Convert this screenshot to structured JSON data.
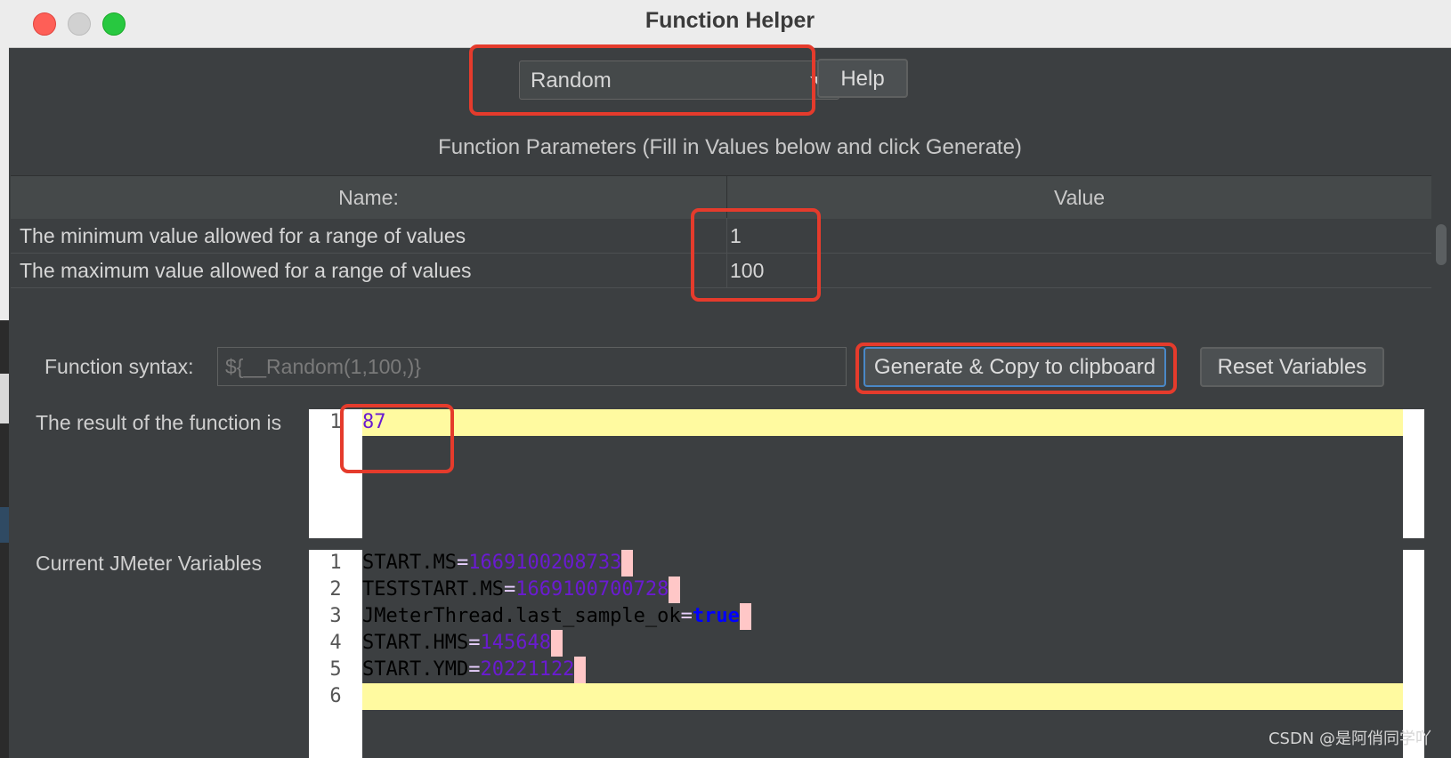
{
  "window": {
    "title": "Function Helper"
  },
  "top": {
    "function_select": "Random",
    "help_button": "Help"
  },
  "params": {
    "heading": "Function Parameters (Fill in Values below and click Generate)",
    "columns": [
      "Name:",
      "Value"
    ],
    "rows": [
      {
        "name": "The minimum value allowed for a range of values",
        "value": "1"
      },
      {
        "name": "The maximum value allowed for a range of values",
        "value": "100"
      }
    ]
  },
  "syntax": {
    "label": "Function syntax:",
    "value": "${__Random(1,100,)}",
    "generate_button": "Generate & Copy to clipboard",
    "reset_button": "Reset Variables"
  },
  "result": {
    "label": "The result of the function is",
    "line_numbers": [
      "1"
    ],
    "value": "87"
  },
  "variables": {
    "label": "Current JMeter Variables",
    "line_numbers": [
      "1",
      "2",
      "3",
      "4",
      "5",
      "6"
    ],
    "lines": [
      {
        "key": "START.MS",
        "value": "1669100208733"
      },
      {
        "key": "TESTSTART.MS",
        "value": "1669100700728"
      },
      {
        "key": "JMeterThread.last_sample_ok",
        "value": "true"
      },
      {
        "key": "START.HMS",
        "value": "145648"
      },
      {
        "key": "START.YMD",
        "value": "20221122"
      }
    ]
  },
  "watermark": "CSDN @是阿俏同学吖",
  "colors": {
    "highlight_border": "#e53b2c",
    "current_line": "#fffaa0",
    "number_token": "#6a1bd1",
    "boolean_token": "#0000ff"
  }
}
